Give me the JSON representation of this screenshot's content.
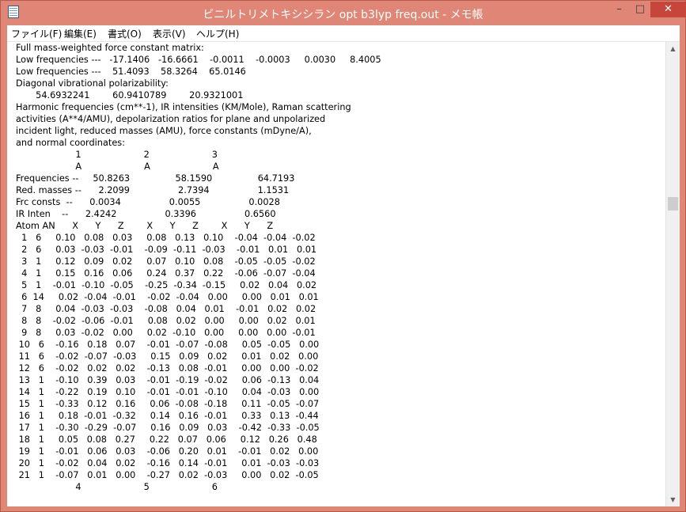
{
  "window": {
    "title": "ビニルトリメトキシシラン opt b3lyp freq.out - メモ帳",
    "buttons": {
      "minimize": "–",
      "maximize": "□",
      "close": "✕"
    }
  },
  "menu": [
    "ファイル(F)",
    "編集(E)",
    "書式(O)",
    "表示(V)",
    "ヘルプ(H)"
  ],
  "content": [
    "Full mass-weighted force constant matrix:",
    "Low frequencies ---   -17.1406   -16.6661    -0.0011    -0.0003     0.0030     8.4005",
    "Low frequencies ---    51.4093    58.3264    65.0146",
    "Diagonal vibrational polarizability:",
    "       54.6932241        60.9410789        20.9321001",
    "Harmonic frequencies (cm**-1), IR intensities (KM/Mole), Raman scattering",
    "activities (A**4/AMU), depolarization ratios for plane and unpolarized",
    "incident light, reduced masses (AMU), force constants (mDyne/A),",
    "and normal coordinates:",
    "                     1                      2                      3",
    "                     A                      A                      A",
    "Frequencies --     50.8263                58.1590                64.7193",
    "Red. masses --      2.2099                 2.7394                 1.1531",
    "Frc consts  --      0.0034                 0.0055                 0.0028",
    "IR Inten    --      2.4242                 0.3396                 0.6560",
    "Atom AN      X      Y      Z        X      Y      Z        X      Y      Z",
    "  1   6     0.10   0.08   0.03     0.08   0.13   0.10    -0.04  -0.04  -0.02",
    "  2   6     0.03  -0.03  -0.01    -0.09  -0.11  -0.03    -0.01   0.01   0.01",
    "  3   1     0.12   0.09   0.02     0.07   0.10   0.08    -0.05  -0.05  -0.02",
    "  4   1     0.15   0.16   0.06     0.24   0.37   0.22    -0.06  -0.07  -0.04",
    "  5   1    -0.01  -0.10  -0.05    -0.25  -0.34  -0.15     0.02   0.04   0.02",
    "  6  14     0.02  -0.04  -0.01    -0.02  -0.04   0.00     0.00   0.01   0.01",
    "  7   8     0.04  -0.03  -0.03    -0.08   0.04   0.01    -0.01   0.02   0.02",
    "  8   8    -0.02  -0.06  -0.01     0.08   0.02   0.00     0.00   0.02   0.01",
    "  9   8     0.03  -0.02   0.00     0.02  -0.10   0.00     0.00   0.00  -0.01",
    " 10   6    -0.16   0.18   0.07    -0.01  -0.07  -0.08     0.05  -0.05   0.00",
    " 11   6    -0.02  -0.07  -0.03     0.15   0.09   0.02     0.01   0.02   0.00",
    " 12   6    -0.02   0.02   0.02    -0.13   0.08  -0.01     0.00   0.00  -0.02",
    " 13   1    -0.10   0.39   0.03    -0.01  -0.19  -0.02     0.06  -0.13   0.04",
    " 14   1    -0.22   0.19   0.10    -0.01  -0.01  -0.10     0.04  -0.03   0.00",
    " 15   1    -0.33   0.12   0.16     0.06  -0.08  -0.18     0.11  -0.05  -0.07",
    " 16   1     0.18  -0.01  -0.32     0.14   0.16  -0.01     0.33   0.13  -0.44",
    " 17   1    -0.30  -0.29  -0.07     0.16   0.09   0.03    -0.42  -0.33  -0.05",
    " 18   1     0.05   0.08   0.27     0.22   0.07   0.06     0.12   0.26   0.48",
    " 19   1    -0.01   0.06   0.03    -0.06   0.20   0.01    -0.01   0.02   0.00",
    " 20   1    -0.02   0.04   0.02    -0.16   0.14  -0.01     0.01  -0.03  -0.03",
    " 21   1    -0.07   0.01   0.00    -0.27   0.02  -0.03     0.00   0.02  -0.05",
    "                     4                      5                      6"
  ],
  "scrollbar": {
    "up": "▲",
    "down": "▼"
  }
}
